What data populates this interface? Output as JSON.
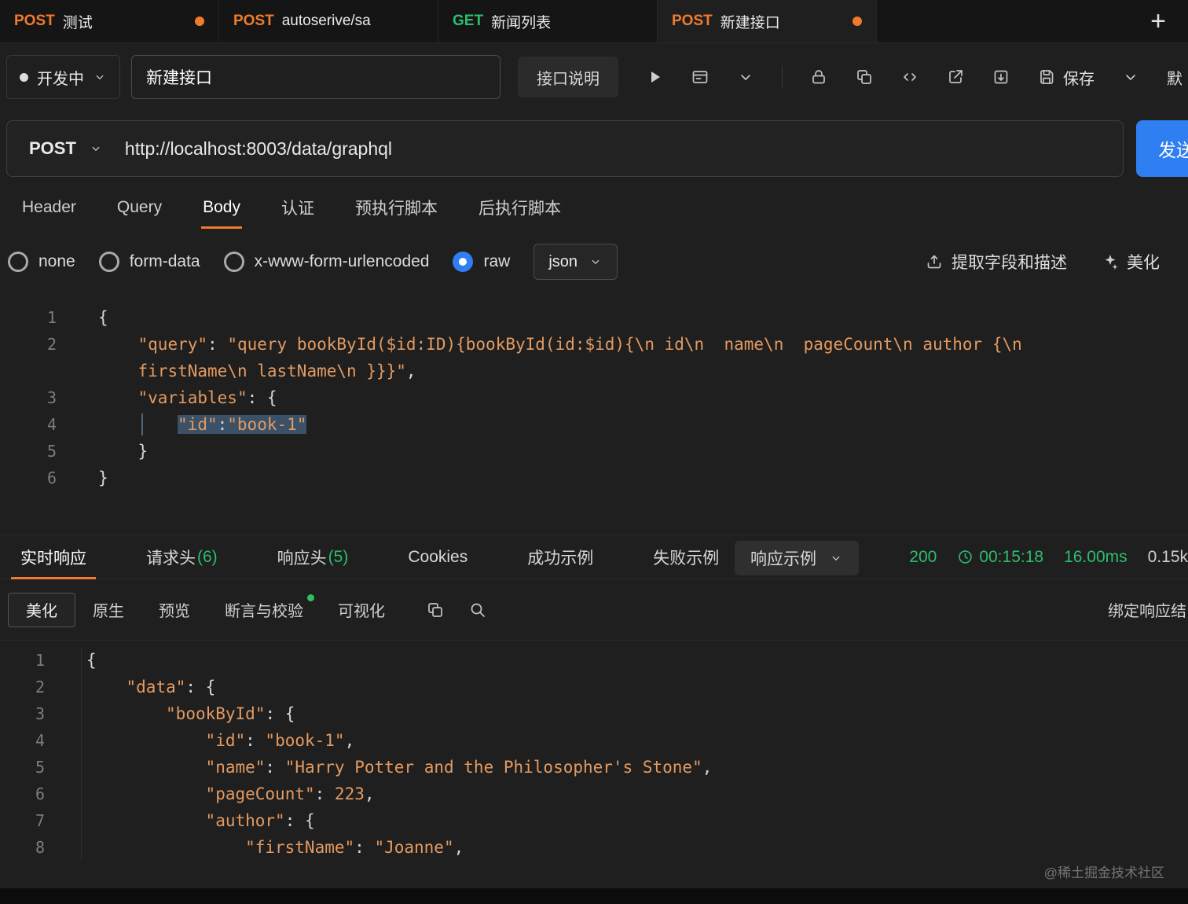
{
  "colors": {
    "orange": "#ef7b2d",
    "green": "#2dbd6e",
    "blue": "#2f7ef2",
    "code_orange": "#e39a61"
  },
  "topbar": {
    "tabs": [
      {
        "method": "POST",
        "label": "测试",
        "dot": true,
        "active": false
      },
      {
        "method": "POST",
        "label": "autoserive/sa",
        "dot": false,
        "active": false
      },
      {
        "method": "GET",
        "label": "新闻列表",
        "dot": false,
        "active": false
      },
      {
        "method": "POST",
        "label": "新建接口",
        "dot": true,
        "active": true
      }
    ],
    "add_label": "+"
  },
  "header": {
    "status": {
      "label": "开发中"
    },
    "api_name": "新建接口",
    "doc_button": "接口说明",
    "save_label": "保存",
    "env_label": "默认环境"
  },
  "request": {
    "method": "POST",
    "url": "http://localhost:8003/data/graphql",
    "send_label": "发送"
  },
  "request_tabs": {
    "items": [
      {
        "label": "Header",
        "active": false
      },
      {
        "label": "Query",
        "active": false
      },
      {
        "label": "Body",
        "active": true
      },
      {
        "label": "认证",
        "active": false
      },
      {
        "label": "预执行脚本",
        "active": false
      },
      {
        "label": "后执行脚本",
        "active": false
      }
    ]
  },
  "body_bar": {
    "types": [
      {
        "label": "none",
        "selected": false
      },
      {
        "label": "form-data",
        "selected": false
      },
      {
        "label": "x-www-form-urlencoded",
        "selected": false
      },
      {
        "label": "raw",
        "selected": true
      }
    ],
    "format": "json",
    "extract_label": "提取字段和描述",
    "beautify_label": "美化"
  },
  "request_body": {
    "lines": [
      {
        "num": 1,
        "indent": 0,
        "tokens": [
          {
            "c": "p",
            "t": "{"
          }
        ]
      },
      {
        "num": 2,
        "indent": 4,
        "tokens": [
          {
            "c": "s",
            "t": "\"query\""
          },
          {
            "c": "p",
            "t": ": "
          },
          {
            "c": "s",
            "t": "\"query bookById($id:ID){bookById(id:$id){\\n id\\n  name\\n  pageCount\\n author {\\n firstName\\n lastName\\n }}}\""
          },
          {
            "c": "p",
            "t": ","
          }
        ]
      },
      {
        "num": 3,
        "indent": 4,
        "tokens": [
          {
            "c": "s",
            "t": "\"variables\""
          },
          {
            "c": "p",
            "t": ": {"
          }
        ]
      },
      {
        "num": 4,
        "indent": 8,
        "guide": 4,
        "tokens": [
          {
            "c": "s-sel",
            "t": "\"id\""
          },
          {
            "c": "p-sel",
            "t": ":"
          },
          {
            "c": "s-sel",
            "t": "\"book-1\""
          }
        ]
      },
      {
        "num": 5,
        "indent": 4,
        "tokens": [
          {
            "c": "p",
            "t": "}"
          }
        ]
      },
      {
        "num": 6,
        "indent": 0,
        "tokens": [
          {
            "c": "p",
            "t": "}"
          }
        ]
      }
    ]
  },
  "response_bar": {
    "tabs": [
      {
        "label": "实时响应",
        "active": true
      },
      {
        "label": "请求头",
        "count": "(6)"
      },
      {
        "label": "响应头",
        "count": "(5)"
      },
      {
        "label": "Cookies"
      },
      {
        "label": "成功示例"
      },
      {
        "label": "失败示例"
      }
    ],
    "sample_select": "响应示例",
    "status": "200",
    "time": "00:15:18",
    "duration": "16.00ms",
    "size": "0.15k"
  },
  "response_toolbar": {
    "views": [
      {
        "label": "美化",
        "active": true
      },
      {
        "label": "原生"
      },
      {
        "label": "预览"
      },
      {
        "label": "断言与校验",
        "dot": true
      },
      {
        "label": "可视化"
      }
    ],
    "bind_label": "绑定响应结"
  },
  "response_body": {
    "lines": [
      {
        "num": 1,
        "indent": 0,
        "tokens": [
          {
            "c": "p",
            "t": "{"
          }
        ]
      },
      {
        "num": 2,
        "indent": 4,
        "tokens": [
          {
            "c": "s",
            "t": "\"data\""
          },
          {
            "c": "p",
            "t": ": {"
          }
        ]
      },
      {
        "num": 3,
        "indent": 8,
        "tokens": [
          {
            "c": "s",
            "t": "\"bookById\""
          },
          {
            "c": "p",
            "t": ": {"
          }
        ]
      },
      {
        "num": 4,
        "indent": 12,
        "tokens": [
          {
            "c": "s",
            "t": "\"id\""
          },
          {
            "c": "p",
            "t": ": "
          },
          {
            "c": "s",
            "t": "\"book-1\""
          },
          {
            "c": "p",
            "t": ","
          }
        ]
      },
      {
        "num": 5,
        "indent": 12,
        "tokens": [
          {
            "c": "s",
            "t": "\"name\""
          },
          {
            "c": "p",
            "t": ": "
          },
          {
            "c": "s",
            "t": "\"Harry Potter and the Philosopher's Stone\""
          },
          {
            "c": "p",
            "t": ","
          }
        ]
      },
      {
        "num": 6,
        "indent": 12,
        "tokens": [
          {
            "c": "s",
            "t": "\"pageCount\""
          },
          {
            "c": "p",
            "t": ": "
          },
          {
            "c": "n",
            "t": "223"
          },
          {
            "c": "p",
            "t": ","
          }
        ]
      },
      {
        "num": 7,
        "indent": 12,
        "tokens": [
          {
            "c": "s",
            "t": "\"author\""
          },
          {
            "c": "p",
            "t": ": {"
          }
        ]
      },
      {
        "num": 8,
        "indent": 16,
        "tokens": [
          {
            "c": "s",
            "t": "\"firstName\""
          },
          {
            "c": "p",
            "t": ": "
          },
          {
            "c": "s",
            "t": "\"Joanne\""
          },
          {
            "c": "p",
            "t": ","
          }
        ]
      }
    ]
  },
  "watermark": "@稀土掘金技术社区"
}
